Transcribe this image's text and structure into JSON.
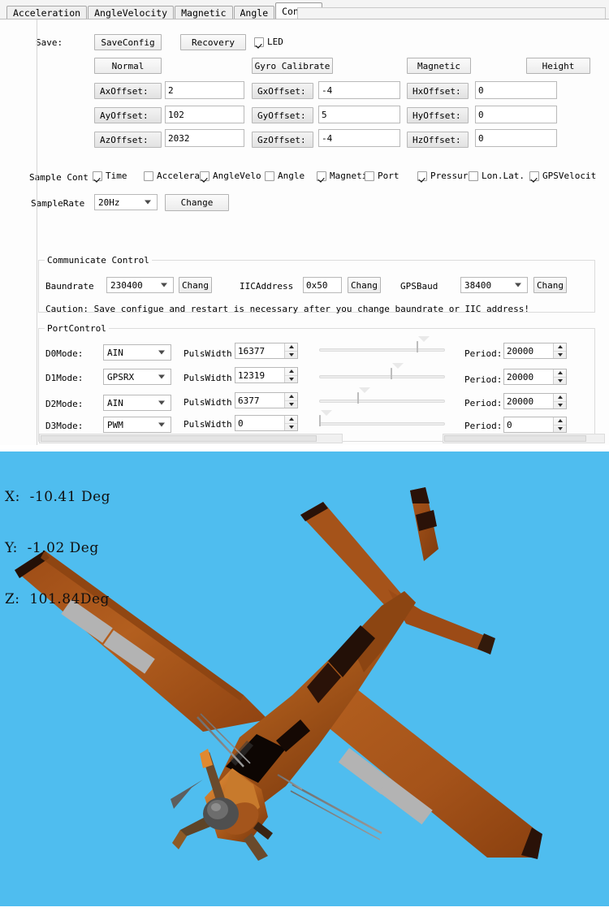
{
  "tabs": [
    {
      "label": "Acceleration",
      "active": false
    },
    {
      "label": "AngleVelocity",
      "active": false
    },
    {
      "label": "Magnetic",
      "active": false
    },
    {
      "label": "Angle",
      "active": false
    },
    {
      "label": "Config",
      "active": true
    }
  ],
  "save_section": {
    "label": "Save:",
    "save_config_button": "SaveConfig",
    "recovery_button": "Recovery",
    "led_checkbox": {
      "label": "LED",
      "checked": true
    },
    "normal_button": "Normal",
    "gyro_calibrate_button": "Gyro Calibrate",
    "magnetic_button": "Magnetic",
    "height_button": "Height"
  },
  "offsets": {
    "rows": [
      {
        "a_label": "AxOffset:",
        "a_value": "2",
        "g_label": "GxOffset:",
        "g_value": "-4",
        "h_label": "HxOffset:",
        "h_value": "0"
      },
      {
        "a_label": "AyOffset:",
        "a_value": "102",
        "g_label": "GyOffset:",
        "g_value": "5",
        "h_label": "HyOffset:",
        "h_value": "0"
      },
      {
        "a_label": "AzOffset:",
        "a_value": "2032",
        "g_label": "GzOffset:",
        "g_value": "-4",
        "h_label": "HzOffset:",
        "h_value": "0"
      }
    ]
  },
  "sample_control": {
    "label": "Sample Cont",
    "checkboxes": [
      {
        "label": "Time",
        "checked": true
      },
      {
        "label": "Accelerat",
        "checked": false
      },
      {
        "label": "AngleVelo",
        "checked": true
      },
      {
        "label": "Angle",
        "checked": false
      },
      {
        "label": "Magneti",
        "checked": true
      },
      {
        "label": "Port",
        "checked": false
      },
      {
        "label": "Pressur",
        "checked": true
      },
      {
        "label": "Lon.Lat.",
        "checked": false
      },
      {
        "label": "GPSVelocit",
        "checked": true
      }
    ],
    "rate_label": "SampleRate",
    "rate_value": "20Hz",
    "change_button": "Change"
  },
  "communicate_control": {
    "title": "Communicate Control",
    "baundrate_label": "Baundrate",
    "baundrate_value": "230400",
    "baundrate_change": "Chang",
    "iicaddress_label": "IICAddress",
    "iicaddress_value": "0x50",
    "iicaddress_change": "Chang",
    "gpsbaud_label": "GPSBaud",
    "gpsbaud_value": "38400",
    "gpsbaud_change": "Chang",
    "caution": "Caution: Save configue and restart is necessary after you change baundrate or IIC address!"
  },
  "port_control": {
    "title": "PortControl",
    "pulswidth_label": "PulsWidth",
    "period_label": "Period:",
    "rows": [
      {
        "mode_label": "D0Mode:",
        "mode_value": "AIN",
        "pulswidth": "16377",
        "slider_pct": 82,
        "period": "20000"
      },
      {
        "mode_label": "D1Mode:",
        "mode_value": "GPSRX",
        "pulswidth": "12319",
        "slider_pct": 61,
        "period": "20000"
      },
      {
        "mode_label": "D2Mode:",
        "mode_value": "AIN",
        "pulswidth": "6377",
        "slider_pct": 32,
        "period": "20000"
      },
      {
        "mode_label": "D3Mode:",
        "mode_value": "PWM",
        "pulswidth": "0",
        "slider_pct": 1,
        "period": "0"
      }
    ]
  },
  "viewport": {
    "background_color": "#4fbdef",
    "readout": {
      "x": "X:  -10.41 Deg",
      "y": "Y:  -1.02 Deg",
      "z": "Z:  101.84Deg"
    },
    "model": {
      "name": "airplane-3d-model",
      "body_color": "#a8521a",
      "body_color_light": "#c2762e",
      "body_color_dark": "#6d3410",
      "marking_color": "#b0b0b0",
      "prop_color": "#5a5a5a"
    }
  }
}
